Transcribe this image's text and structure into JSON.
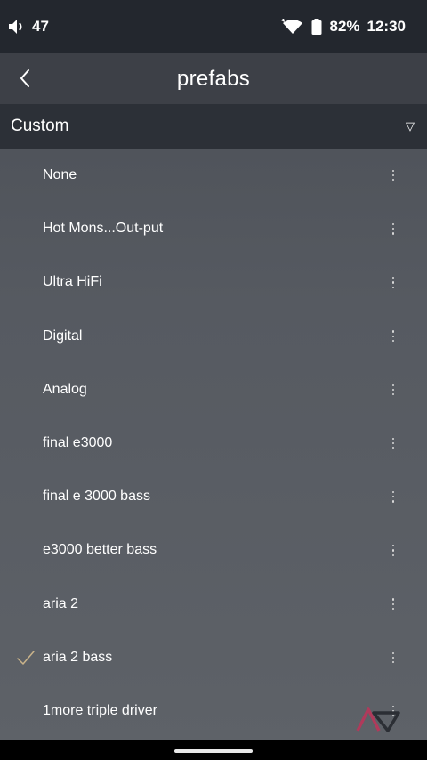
{
  "status_bar": {
    "volume_level": "47",
    "battery": "82%",
    "time": "12:30"
  },
  "header": {
    "title": "prefabs"
  },
  "dropdown": {
    "selected": "Custom",
    "arrow": "▽"
  },
  "presets": [
    {
      "label": "None",
      "selected": false
    },
    {
      "label": "Hot Mons...Out-put",
      "selected": false
    },
    {
      "label": "Ultra HiFi",
      "selected": false
    },
    {
      "label": "Digital",
      "selected": false
    },
    {
      "label": "Analog",
      "selected": false
    },
    {
      "label": "final e3000",
      "selected": false
    },
    {
      "label": "final e 3000 bass",
      "selected": false
    },
    {
      "label": "e3000 better bass",
      "selected": false
    },
    {
      "label": "aria 2",
      "selected": false
    },
    {
      "label": "aria 2 bass",
      "selected": true
    },
    {
      "label": "1more triple driver",
      "selected": false
    }
  ],
  "icons": {
    "back": "chevron-left-icon",
    "more": "more-vertical-icon",
    "check": "check-icon",
    "volume": "volume-icon",
    "wifi": "wifi-icon",
    "battery": "battery-icon",
    "watermark": "android-police-logo-icon"
  },
  "colors": {
    "status_bar_bg": "#23272e",
    "header_bg": "#3d4047",
    "dropdown_bg": "#2c3037",
    "list_bg": "#565a61",
    "check_color": "#c9b38a"
  }
}
